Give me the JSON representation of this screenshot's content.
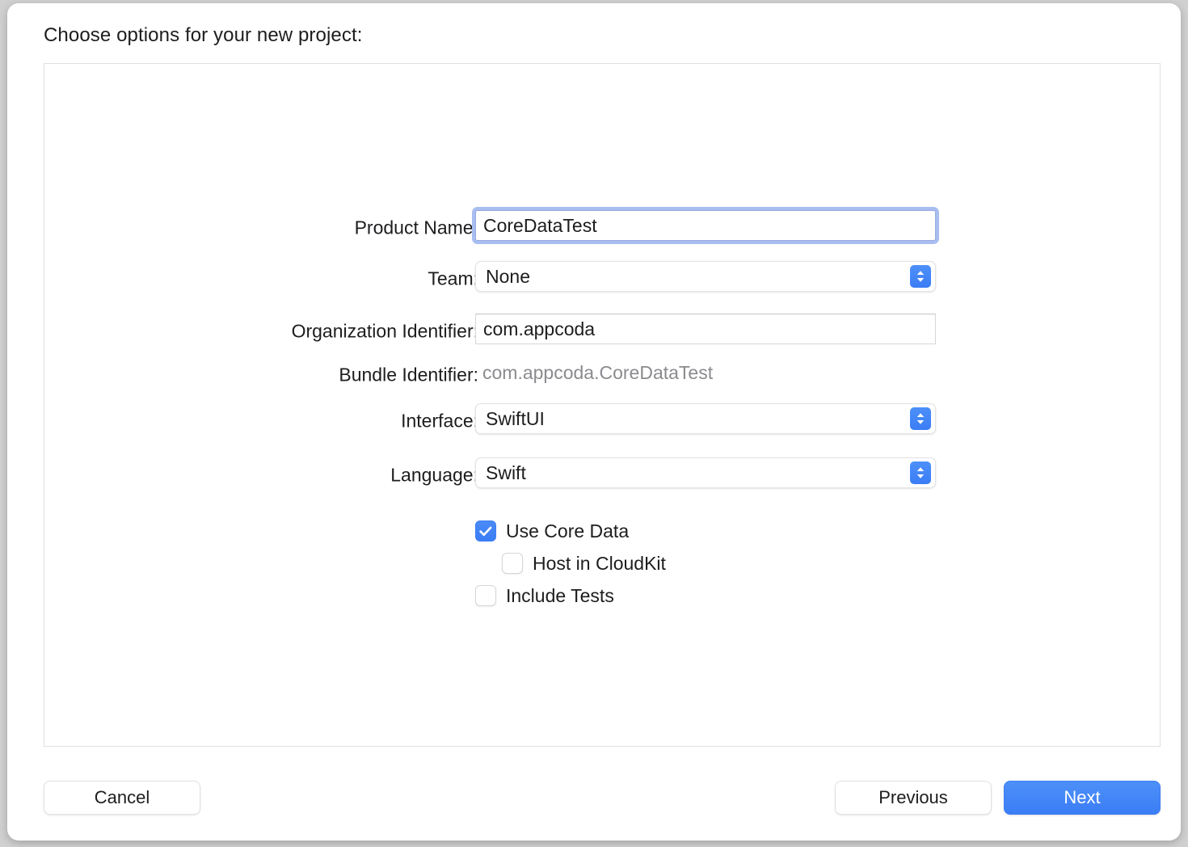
{
  "dialog": {
    "heading": "Choose options for your new project:"
  },
  "form": {
    "fields": [
      {
        "id": "product-name",
        "label": "Product Name:",
        "type": "textfield",
        "value": "CoreDataTest",
        "focused": true
      },
      {
        "id": "team",
        "label": "Team:",
        "type": "popup",
        "value": "None"
      },
      {
        "id": "organization-identifier",
        "label": "Organization Identifier:",
        "type": "textfield",
        "value": "com.appcoda",
        "focused": false
      },
      {
        "id": "bundle-identifier",
        "label": "Bundle Identifier:",
        "type": "static",
        "value": "com.appcoda.CoreDataTest"
      },
      {
        "id": "interface",
        "label": "Interface:",
        "type": "popup",
        "value": "SwiftUI"
      },
      {
        "id": "language",
        "label": "Language:",
        "type": "popup",
        "value": "Swift"
      }
    ],
    "checkboxes": [
      {
        "id": "use-core-data",
        "label": "Use Core Data",
        "checked": true,
        "indented": false
      },
      {
        "id": "host-in-cloudkit",
        "label": "Host in CloudKit",
        "checked": false,
        "indented": true
      },
      {
        "id": "include-tests",
        "label": "Include Tests",
        "checked": false,
        "indented": false
      }
    ]
  },
  "footer": {
    "cancel_label": "Cancel",
    "previous_label": "Previous",
    "next_label": "Next"
  },
  "colors": {
    "accent_blue": "#3b7df5",
    "focus_ring": "#a8bdf0",
    "muted_text": "#8b8b8f",
    "panel_border": "#e0e0e0",
    "window_background": "#ffffff",
    "desktop_background": "#d0d0d0"
  }
}
